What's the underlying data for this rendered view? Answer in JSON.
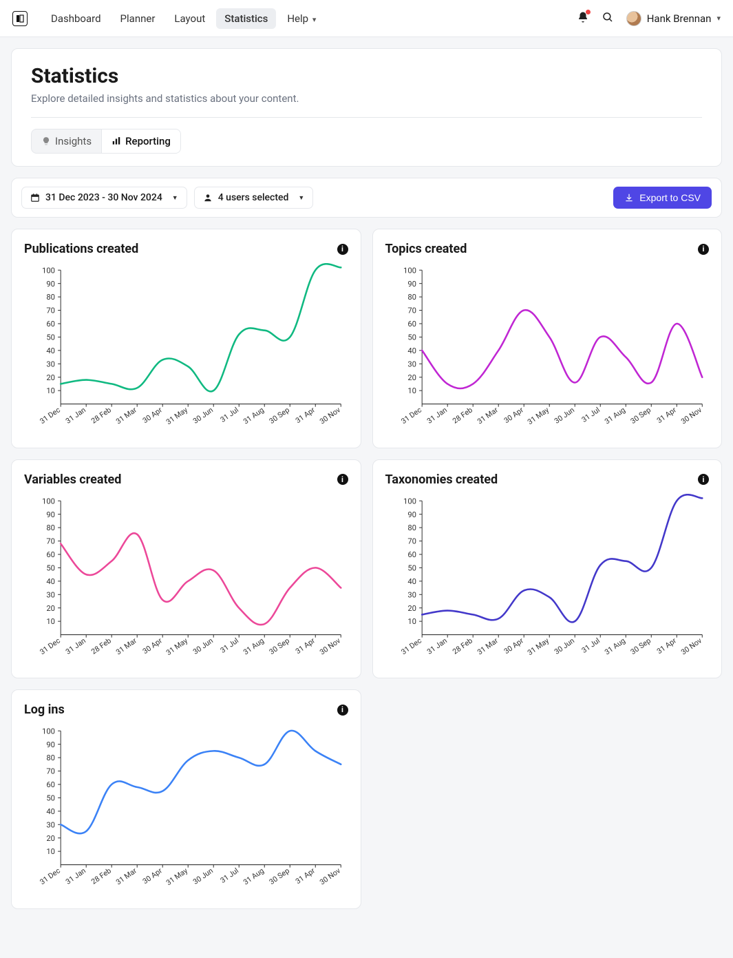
{
  "nav": {
    "items": [
      "Dashboard",
      "Planner",
      "Layout",
      "Statistics",
      "Help"
    ],
    "active_index": 3,
    "user_name": "Hank Brennan"
  },
  "page": {
    "title": "Statistics",
    "subtitle": "Explore detailed insights and statistics about your content.",
    "tabs": {
      "insights": "Insights",
      "reporting": "Reporting",
      "active": "reporting"
    }
  },
  "filters": {
    "date_range": "31 Dec 2023 - 30 Nov 2024",
    "users": "4 users selected",
    "export_label": "Export to CSV"
  },
  "chart_common": {
    "y_ticks": [
      10,
      20,
      30,
      40,
      50,
      60,
      70,
      80,
      90,
      100
    ],
    "x_categories": [
      "31 Dec",
      "31 Jan",
      "28 Feb",
      "31 Mar",
      "30 Apr",
      "31 May",
      "30 Jun",
      "31 Jul",
      "31 Aug",
      "30 Sep",
      "31 Apr",
      "30 Nov"
    ],
    "ylim": [
      0,
      100
    ]
  },
  "chart_data": [
    {
      "id": "publications",
      "title": "Publications created",
      "type": "line",
      "color": "#10b981",
      "values": [
        15,
        18,
        15,
        12,
        33,
        28,
        10,
        52,
        55,
        50,
        100,
        102
      ]
    },
    {
      "id": "topics",
      "title": "Topics created",
      "type": "line",
      "color": "#c026d3",
      "values": [
        40,
        15,
        15,
        40,
        70,
        50,
        16,
        50,
        35,
        16,
        60,
        20
      ]
    },
    {
      "id": "variables",
      "title": "Variables created",
      "type": "line",
      "color": "#ec4899",
      "values": [
        68,
        45,
        55,
        75,
        26,
        40,
        48,
        20,
        8,
        35,
        50,
        35
      ]
    },
    {
      "id": "taxonomies",
      "title": "Taxonomies created",
      "type": "line",
      "color": "#4338ca",
      "values": [
        15,
        18,
        15,
        12,
        33,
        28,
        10,
        52,
        55,
        50,
        100,
        102
      ]
    },
    {
      "id": "logins",
      "title": "Log ins",
      "type": "line",
      "color": "#3b82f6",
      "values": [
        30,
        25,
        60,
        58,
        55,
        78,
        85,
        80,
        75,
        100,
        85,
        75
      ]
    }
  ]
}
